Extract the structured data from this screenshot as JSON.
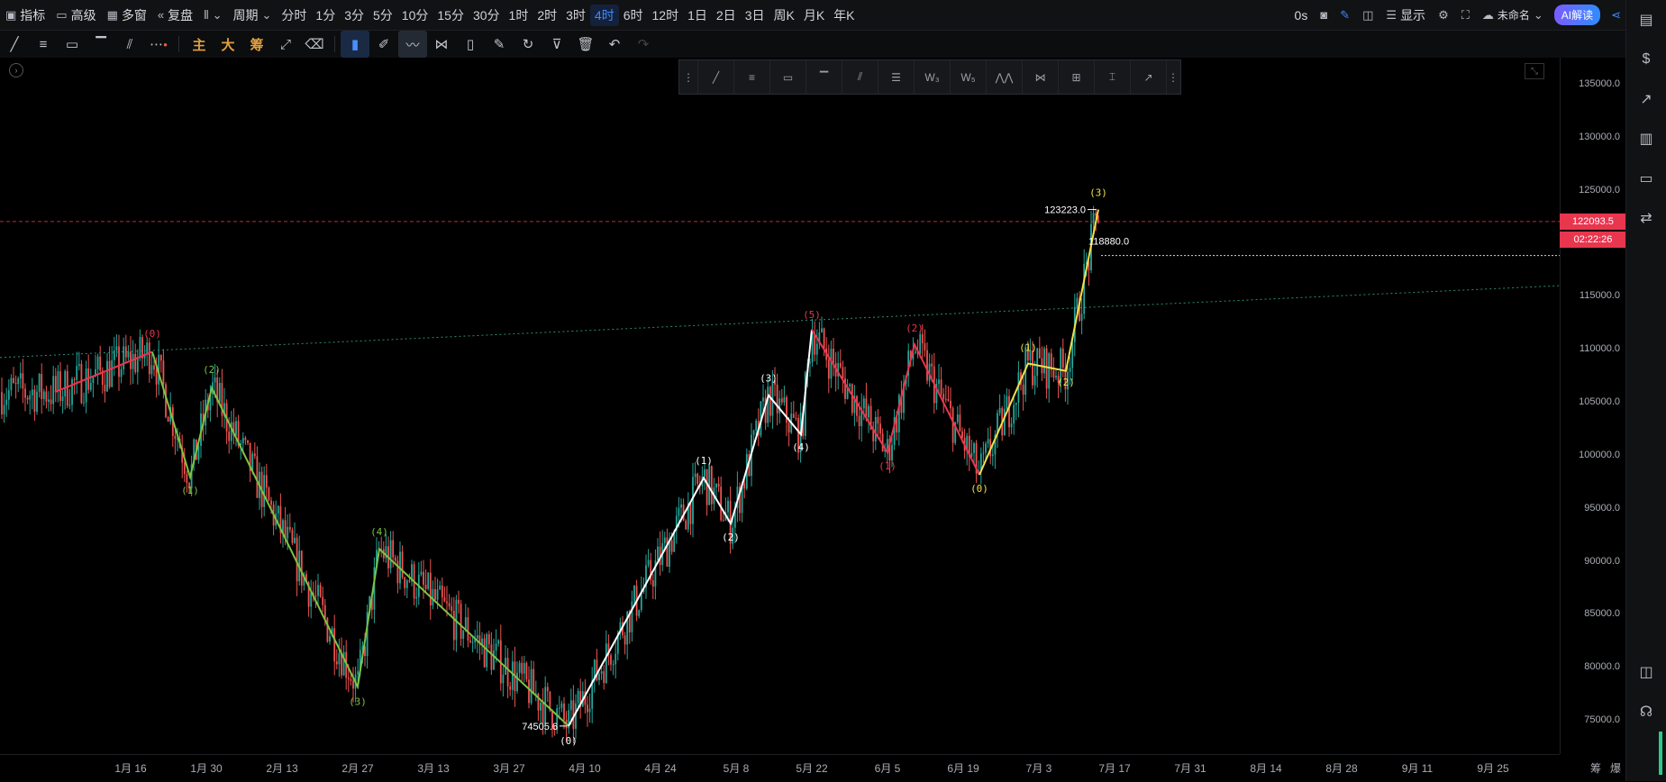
{
  "topbar": {
    "indicators": "指标",
    "advanced": "高级",
    "multi_window": "多窗",
    "replay": "复盘",
    "period_label": "周期",
    "periods": [
      "分时",
      "1分",
      "3分",
      "5分",
      "10分",
      "15分",
      "30分",
      "1时",
      "2时",
      "3时",
      "4时",
      "6时",
      "12时",
      "1日",
      "2日",
      "3日",
      "周K",
      "月K",
      "年K"
    ],
    "active_period": "4时",
    "right": {
      "countdown": "0s",
      "display": "显示",
      "unnamed": "未命名",
      "ai_button": "AI解读"
    }
  },
  "toolbar2": {
    "text_buttons": [
      "主",
      "大",
      "筹"
    ]
  },
  "axis": {
    "y_labels": [
      "135000.0",
      "130000.0",
      "125000.0",
      "120000.0",
      "115000.0",
      "110000.0",
      "105000.0",
      "100000.0",
      "95000.0",
      "90000.0",
      "85000.0",
      "80000.0",
      "75000.0"
    ],
    "x_labels": [
      "1月 16",
      "1月 30",
      "2月 13",
      "2月 27",
      "3月 13",
      "3月 27",
      "4月 10",
      "4月 24",
      "5月 8",
      "5月 22",
      "6月 5",
      "6月 19",
      "7月 3",
      "7月 17",
      "7月 31",
      "8月 14",
      "8月 28",
      "9月 11",
      "9月 25"
    ],
    "x_right_labels": [
      "筹",
      "爆"
    ]
  },
  "price_tags": {
    "last_price": "122093.5",
    "countdown": "02:22:26"
  },
  "annotations": {
    "high": "123223.0",
    "low": "74505.6",
    "level": "118880.0"
  },
  "colors": {
    "up": "#26a69a",
    "down": "#ef5350",
    "wave_green": "#7cc343",
    "wave_white": "#ffffff",
    "wave_red": "#e8364f",
    "wave_yellow": "#f2e04a",
    "accent": "#3d8bff"
  },
  "chart_data": {
    "type": "candlestick",
    "y_range": [
      72000,
      137000
    ],
    "waves": [
      {
        "name": "red_pre",
        "color": "#e8364f",
        "points": [
          [
            "1月 2",
            106000
          ],
          [
            "1月 20",
            109800
          ]
        ]
      },
      {
        "name": "green",
        "color": "#7cc343",
        "points": [
          [
            "1月 20",
            109800
          ],
          [
            "1月 27",
            98000
          ],
          [
            "1月 31",
            106400
          ],
          [
            "2月 27",
            78200
          ],
          [
            "3月 3",
            91200
          ],
          [
            "4月 7",
            74500
          ]
        ]
      },
      {
        "name": "white",
        "color": "#ffffff",
        "points": [
          [
            "4月 7",
            74500
          ],
          [
            "5月 2",
            97900
          ],
          [
            "5月 7",
            93600
          ],
          [
            "5月 14",
            105700
          ],
          [
            "5月 20",
            102000
          ],
          [
            "5月 22",
            111900
          ]
        ]
      },
      {
        "name": "red",
        "color": "#e8364f",
        "points": [
          [
            "5月 22",
            111900
          ],
          [
            "6月 5",
            100300
          ],
          [
            "6月 10",
            110500
          ],
          [
            "6月 22",
            98200
          ]
        ]
      },
      {
        "name": "yellow",
        "color": "#f2e04a",
        "points": [
          [
            "6月 22",
            98200
          ],
          [
            "7月 1",
            108700
          ],
          [
            "7月 8",
            108000
          ],
          [
            "7月 14",
            123223
          ]
        ]
      }
    ],
    "wave_labels": [
      {
        "text": "(0)",
        "color": "#e8364f",
        "pos": [
          "1月 20",
          111200
        ]
      },
      {
        "text": "(1)",
        "color": "#7cc343",
        "pos": [
          "1月 27",
          96400
        ]
      },
      {
        "text": "(2)",
        "color": "#7cc343",
        "pos": [
          "1月 31",
          107800
        ]
      },
      {
        "text": "(3)",
        "color": "#7cc343",
        "pos": [
          "2月 27",
          76500
        ]
      },
      {
        "text": "(4)",
        "color": "#7cc343",
        "pos": [
          "3月 3",
          92500
        ]
      },
      {
        "text": "(0)",
        "color": "#ffffff",
        "pos": [
          "4月 7",
          72800
        ]
      },
      {
        "text": "(1)",
        "color": "#ffffff",
        "pos": [
          "5月 2",
          99200
        ]
      },
      {
        "text": "(2)",
        "color": "#ffffff",
        "pos": [
          "5月 7",
          92000
        ]
      },
      {
        "text": "(3)",
        "color": "#ffffff",
        "pos": [
          "5月 14",
          107000
        ]
      },
      {
        "text": "(4)",
        "color": "#ffffff",
        "pos": [
          "5月 20",
          100500
        ]
      },
      {
        "text": "(5)",
        "color": "#e8364f",
        "pos": [
          "5月 22",
          113000
        ]
      },
      {
        "text": "(1)",
        "color": "#e8364f",
        "pos": [
          "6月 5",
          98700
        ]
      },
      {
        "text": "(2)",
        "color": "#e8364f",
        "pos": [
          "6月 10",
          111700
        ]
      },
      {
        "text": "(0)",
        "color": "#f2e04a",
        "pos": [
          "6月 22",
          96600
        ]
      },
      {
        "text": "(1)",
        "color": "#f2e04a",
        "pos": [
          "7月 1",
          109900
        ]
      },
      {
        "text": "(2)",
        "color": "#f2e04a",
        "pos": [
          "7月 8",
          106600
        ]
      },
      {
        "text": "(3)",
        "color": "#f2e04a",
        "pos": [
          "7月 14",
          124500
        ]
      }
    ],
    "trendline": {
      "from": [
        "1月 2",
        109500
      ],
      "to": [
        "8月 7",
        114600
      ]
    },
    "hlines": [
      122093.5,
      118880.0
    ]
  }
}
